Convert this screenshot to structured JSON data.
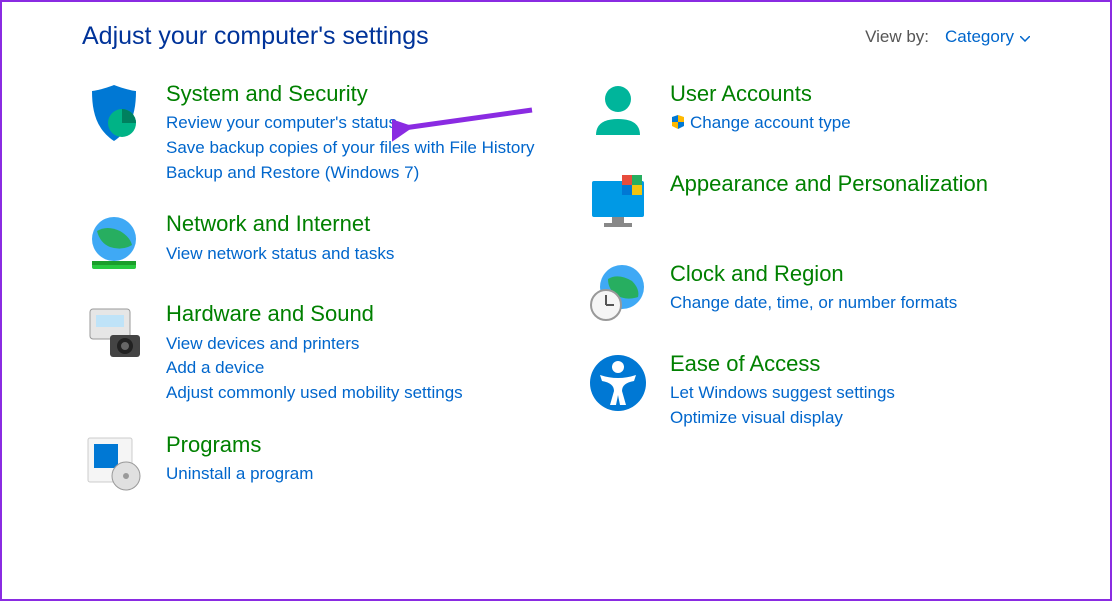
{
  "header": {
    "title": "Adjust your computer's settings",
    "viewby_label": "View by:",
    "viewby_value": "Category"
  },
  "left": [
    {
      "title": "System and Security",
      "links": [
        "Review your computer's status",
        "Save backup copies of your files with File History",
        "Backup and Restore (Windows 7)"
      ]
    },
    {
      "title": "Network and Internet",
      "links": [
        "View network status and tasks"
      ]
    },
    {
      "title": "Hardware and Sound",
      "links": [
        "View devices and printers",
        "Add a device",
        "Adjust commonly used mobility settings"
      ]
    },
    {
      "title": "Programs",
      "links": [
        "Uninstall a program"
      ]
    }
  ],
  "right": [
    {
      "title": "User Accounts",
      "links": [
        "Change account type"
      ],
      "shield": true
    },
    {
      "title": "Appearance and Personalization",
      "links": []
    },
    {
      "title": "Clock and Region",
      "links": [
        "Change date, time, or number formats"
      ]
    },
    {
      "title": "Ease of Access",
      "links": [
        "Let Windows suggest settings",
        "Optimize visual display"
      ]
    }
  ]
}
